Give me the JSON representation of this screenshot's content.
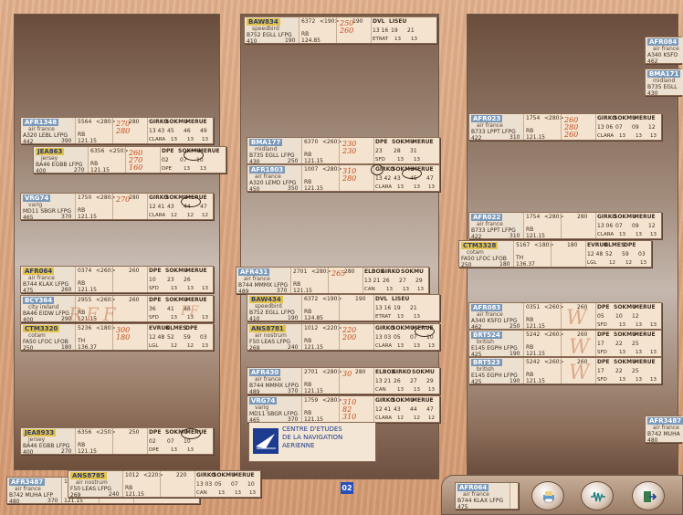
{
  "bays": {
    "left": "",
    "center": "",
    "right": ""
  },
  "logo": {
    "line1": "CENTRE D'ETUDES",
    "line2": "DE LA NAVIGATION",
    "line3": "AERIENNE"
  },
  "pager": {
    "value": "02"
  },
  "handwriting": {
    "ref": "REF",
    "ff": "FF",
    "w1": "W",
    "w2": "W",
    "w3": "W"
  },
  "strips": [
    {
      "id": "baw834",
      "cs": "BAW834",
      "sq": "6372",
      "lvl": "<190>",
      "x": "190",
      "co": "speedbird",
      "ac": "B752",
      "dep": "EGLL",
      "arr": "LFPG",
      "spd": "410",
      "alt": "190",
      "rb": "RB",
      "freq": "124.85",
      "h1": "250",
      "h2": "260",
      "a1": "DVL",
      "a2": "LISEU",
      "b1": "13 16",
      "b2": "19",
      "b3": "21",
      "c1": "ETRAT",
      "c2": "13",
      "c3": "13"
    },
    {
      "id": "afr1348",
      "cs": "AFR1348",
      "sq": "5564",
      "lvl": "<280>",
      "x": "280",
      "co": "air france",
      "ac": "A320",
      "dep": "LEBL",
      "arr": "LFPG",
      "spd": "442",
      "alt": "390",
      "rb": "RB",
      "freq": "121.15",
      "h1": "270",
      "h2": "280",
      "a1": "GIRKO",
      "a2": "SOKMU",
      "a3": "MERUE",
      "b1": "13 43",
      "b2": "45",
      "b3": "46",
      "b4": "49",
      "c1": "CLARA",
      "c2": "13",
      "c3": "13",
      "c4": "13"
    },
    {
      "id": "jea863",
      "cs": "JEA863",
      "sq": "6356",
      "lvl": "<250>",
      "x": "",
      "co": "jersey",
      "ac": "BA46",
      "dep": "EGBB",
      "arr": "LFPG",
      "spd": "400",
      "alt": "270",
      "rb": "RB",
      "freq": "121.15",
      "h1": "260",
      "h2": "270",
      "h3": "160",
      "a1": "DPE",
      "a2": "SOKMU",
      "a3": "MERUE",
      "b1": "02",
      "b2": "07",
      "b3": "10",
      "c1": "DPE",
      "c2": "13",
      "c3": "13"
    },
    {
      "id": "vrg74",
      "cs": "VRG74",
      "sq": "1750",
      "lvl": "<280>",
      "x": "280",
      "co": "varig",
      "ac": "MD11",
      "dep": "SBGR",
      "arr": "LFPG",
      "spd": "465",
      "alt": "370",
      "rb": "RB",
      "freq": "121.15",
      "h1": "270",
      "a1": "GIRKO",
      "a2": "SOKMU",
      "a3": "MERUE",
      "b1": "12 41",
      "b2": "43",
      "b3": "44",
      "b4": "47",
      "c1": "CLARA",
      "c2": "12",
      "c3": "12",
      "c4": "12"
    },
    {
      "id": "afr064",
      "cs": "AFR064",
      "sq": "0374",
      "lvl": "<260>",
      "x": "260",
      "co": "air france",
      "ac": "B744",
      "dep": "KLAX",
      "arr": "LFPG",
      "spd": "475",
      "alt": "260",
      "rb": "RB",
      "freq": "121.15",
      "a1": "DPE",
      "a2": "SOKMU",
      "a3": "MERUE",
      "b1": "10",
      "b2": "23",
      "b3": "26",
      "c1": "SFD",
      "c2": "13",
      "c3": "13",
      "c4": "13"
    },
    {
      "id": "bcy364",
      "cs": "BCY364",
      "sq": "2955",
      "lvl": "<260>",
      "x": "260",
      "co": "city ireland",
      "ac": "BA46",
      "dep": "EIDW",
      "arr": "LFPG",
      "spd": "400",
      "alt": "290",
      "rb": "RB",
      "freq": "121.15",
      "a1": "DPE",
      "a2": "SOKMU",
      "a3": "MERUE",
      "b1": "36",
      "b2": "41",
      "b3": "46",
      "c1": "SFD",
      "c2": "13",
      "c3": "13",
      "c4": "13"
    },
    {
      "id": "ctm3320",
      "cs": "CTM3320",
      "sq": "5236",
      "lvl": "<180>",
      "x": "",
      "co": "cotam",
      "ac": "FA50",
      "dep": "LFOC",
      "arr": "LFOB",
      "spd": "250",
      "alt": "180",
      "rb": "TH",
      "freq": "136.37",
      "h1": "300",
      "h2": "180",
      "a1": "EVRUK",
      "a2": "OLMES",
      "a3": "DPE",
      "b1": "12 48",
      "b2": "52",
      "b3": "59",
      "b4": "03",
      "c1": "LGL",
      "c2": "12",
      "c3": "12",
      "c4": "13"
    },
    {
      "id": "jea8933",
      "cs": "JEA8933",
      "sq": "6356",
      "lvl": "<250>",
      "x": "250",
      "co": "jersey",
      "ac": "BA46",
      "dep": "EGBB",
      "arr": "LFPG",
      "spd": "400",
      "alt": "270",
      "rb": "RB",
      "freq": "121.15",
      "a1": "DPE",
      "a2": "SOKMU",
      "a3": "MERUE",
      "b1": "02",
      "b2": "07",
      "b3": "10",
      "c1": "DPE",
      "c2": "13",
      "c3": "13"
    },
    {
      "id": "afr3487",
      "cs": "AFR3487",
      "sq": "17",
      "co": "air france",
      "ac": "B742",
      "dep": "MUHA",
      "arr": "LFP",
      "spd": "480",
      "alt": "370",
      "rb": "",
      "freq": "121.15"
    },
    {
      "id": "ans8785",
      "cs": "ANS8785",
      "sq": "1012",
      "lvl": "<220>",
      "x": "220",
      "co": "air nostrum",
      "ac": "F50",
      "dep": "LEAS",
      "arr": "LFPG",
      "spd": "269",
      "alt": "240",
      "rb": "RB",
      "freq": "121.15",
      "a1": "GIRKO",
      "a2": "SOKMU",
      "a3": "MERUE",
      "b1": "13 03",
      "b2": "05",
      "b3": "07",
      "b4": "10",
      "c1": "CAN",
      "c2": "13",
      "c3": "13",
      "c4": "13"
    },
    {
      "id": "bma177",
      "cs": "BMA177",
      "sq": "6370",
      "lvl": "<260>",
      "x": "",
      "co": "midland",
      "ac": "B735",
      "dep": "EGLL",
      "arr": "LFPG",
      "spd": "430",
      "alt": "250",
      "rb": "RB",
      "freq": "121.15",
      "h1": "230",
      "h2": "230",
      "a1": "DPE",
      "a2": "SOKMU",
      "a3": "MERUE",
      "b1": "23",
      "b2": "28",
      "b3": "31",
      "c1": "SFD",
      "c2": "13",
      "c3": "13"
    },
    {
      "id": "afr1803",
      "cs": "AFR1803",
      "sq": "1007",
      "lvl": "<280>",
      "x": "",
      "co": "air france",
      "ac": "A320",
      "dep": "LEMD",
      "arr": "LFPG",
      "spd": "450",
      "alt": "350",
      "rb": "RB",
      "freq": "121.15",
      "h1": "310",
      "h2": "280",
      "a1": "GIRKO",
      "a2": "SOKMU",
      "a3": "MERUE",
      "b1": "13 42",
      "b2": "43",
      "b3": "45",
      "b4": "47",
      "c1": "CLARA",
      "c2": "13",
      "c3": "13",
      "c4": "13"
    },
    {
      "id": "afr431",
      "cs": "AFR431",
      "sq": "2701",
      "lvl": "<280>",
      "x": "280",
      "co": "air france",
      "ac": "B744",
      "dep": "MMMX",
      "arr": "LFPG",
      "spd": "489",
      "alt": "370",
      "rb": "RB",
      "freq": "121.15",
      "h1": "265",
      "a1": "ELBOX",
      "a2": "GIRKO",
      "a3": "SOKMU",
      "b1": "13 21",
      "b2": "26",
      "b3": "27",
      "b4": "29",
      "c1": "CAN",
      "c2": "13",
      "c3": "13",
      "c4": "13"
    },
    {
      "id": "baw434",
      "cs": "BAW434",
      "sq": "6372",
      "lvl": "<190>",
      "x": "190",
      "co": "speedbird",
      "ac": "B752",
      "dep": "EGLL",
      "arr": "LFPO",
      "spd": "410",
      "alt": "190",
      "rb": "RB",
      "freq": "124.85",
      "a1": "DVL",
      "a2": "LISEU",
      "b1": "13 16",
      "b2": "19",
      "b3": "21",
      "c1": "ETRAT",
      "c2": "13",
      "c3": "13"
    },
    {
      "id": "ans8781",
      "cs": "ANS8781",
      "sq": "1012",
      "lvl": "<220>",
      "x": "",
      "co": "air nostrum",
      "ac": "F50",
      "dep": "LEAS",
      "arr": "LFPG",
      "spd": "269",
      "alt": "240",
      "rb": "RB",
      "freq": "121.15",
      "h1": "220",
      "h2": "200",
      "a1": "GIRKO",
      "a2": "SOKMU",
      "a3": "MERUE",
      "b1": "13 03",
      "b2": "05",
      "b3": "07",
      "b4": "10",
      "c1": "CLARA",
      "c2": "13",
      "c3": "13",
      "c4": "13"
    },
    {
      "id": "afr430",
      "cs": "AFR430",
      "sq": "2701",
      "lvl": "<280>",
      "x": "280",
      "co": "air france",
      "ac": "B744",
      "dep": "MMMX",
      "arr": "LFPG",
      "spd": "489",
      "alt": "370",
      "rb": "RB",
      "freq": "121.15",
      "h1": "30",
      "a1": "ELBOX",
      "a2": "GIRKO",
      "a3": "SOKMU",
      "b1": "13 21",
      "b2": "26",
      "b3": "27",
      "b4": "29",
      "c1": "CAN",
      "c2": "13",
      "c3": "13",
      "c4": "13"
    },
    {
      "id": "vrg74b",
      "cs": "VRG74",
      "sq": "1759",
      "lvl": "<280>",
      "x": "",
      "co": "varig",
      "ac": "MD11",
      "dep": "SBGR",
      "arr": "LFPG",
      "spd": "465",
      "alt": "370",
      "rb": "RB",
      "freq": "121.15",
      "h1": "310",
      "h2": "82",
      "h3": "310",
      "a1": "GIRKO",
      "a2": "SOKMU",
      "a3": "MERUE",
      "b1": "12 41",
      "b2": "43",
      "b3": "44",
      "b4": "47",
      "c1": "CLARA",
      "c2": "12",
      "c3": "12",
      "c4": "12"
    },
    {
      "id": "afr023",
      "cs": "AFR023",
      "sq": "1754",
      "lvl": "<280>",
      "x": "",
      "co": "air france",
      "ac": "B733",
      "dep": "LPPT",
      "arr": "LFPG",
      "spd": "422",
      "alt": "310",
      "rb": "RB",
      "freq": "121.15",
      "h1": "260",
      "h2": "280",
      "h3": "260",
      "a1": "GIRKO",
      "a2": "SOKMU",
      "a3": "MERUE",
      "b1": "13 06",
      "b2": "07",
      "b3": "09",
      "b4": "12",
      "c1": "CLARA",
      "c2": "13",
      "c3": "13",
      "c4": "13"
    },
    {
      "id": "afr022",
      "cs": "AFR022",
      "sq": "1754",
      "lvl": "<280>",
      "x": "280",
      "co": "air france",
      "ac": "B733",
      "dep": "LPPT",
      "arr": "LFPG",
      "spd": "422",
      "alt": "310",
      "rb": "RB",
      "freq": "121.15",
      "a1": "GIRKO",
      "a2": "SOKMU",
      "a3": "MERUE",
      "b1": "13 06",
      "b2": "07",
      "b3": "09",
      "b4": "12",
      "c1": "CLARA",
      "c2": "13",
      "c3": "13",
      "c4": "13"
    },
    {
      "id": "ctm3328",
      "cs": "CTM3328",
      "sq": "5167",
      "lvl": "<180>",
      "x": "180",
      "co": "cotam",
      "ac": "FA50",
      "dep": "LFOC",
      "arr": "LFOB",
      "spd": "250",
      "alt": "180",
      "rb": "TH",
      "freq": "136.37",
      "a1": "EVRUK",
      "a2": "OLMES",
      "a3": "DPE",
      "b1": "12 48",
      "b2": "52",
      "b3": "59",
      "b4": "03",
      "c1": "LGL",
      "c2": "12",
      "c3": "12",
      "c4": "13"
    },
    {
      "id": "afr083",
      "cs": "AFR083",
      "sq": "0351",
      "lvl": "<260>",
      "x": "260",
      "co": "air france",
      "ac": "A340",
      "dep": "KSFO",
      "arr": "LFPG",
      "spd": "462",
      "alt": "250",
      "rb": "RB",
      "freq": "121.15",
      "a1": "DPE",
      "a2": "SOKMU",
      "a3": "MERUE",
      "b1": "05",
      "b2": "10",
      "b3": "12",
      "c1": "SFD",
      "c2": "13",
      "c3": "13",
      "c4": "13"
    },
    {
      "id": "brt524",
      "cs": "BRT524",
      "sq": "5242",
      "lvl": "<260>",
      "x": "260",
      "co": "british",
      "ac": "E145",
      "dep": "EGPH",
      "arr": "LFPG",
      "spd": "425",
      "alt": "190",
      "rb": "RB",
      "freq": "121.15",
      "a1": "DPE",
      "a2": "SOKMU",
      "a3": "MERUE",
      "b1": "17",
      "b2": "22",
      "b3": "25",
      "c1": "SFD",
      "c2": "13",
      "c3": "13",
      "c4": "13"
    },
    {
      "id": "brt523",
      "cs": "BRT523",
      "sq": "5242",
      "lvl": "<260>",
      "x": "260",
      "co": "british",
      "ac": "E145",
      "dep": "EGPH",
      "arr": "LFPG",
      "spd": "425",
      "alt": "190",
      "rb": "RB",
      "freq": "121.15",
      "a1": "DPE",
      "a2": "SOKMU",
      "a3": "MERUE",
      "b1": "17",
      "b2": "22",
      "b3": "25",
      "c1": "SFD",
      "c2": "13",
      "c3": "13",
      "c4": "13"
    },
    {
      "id": "afr084",
      "cs": "AFR084",
      "co": "air france",
      "ac": "A340",
      "dep": "KSFO",
      "spd": "462"
    },
    {
      "id": "bma171",
      "cs": "BMA171",
      "co": "midland",
      "ac": "B735",
      "dep": "EGLL",
      "spd": "430"
    },
    {
      "id": "afr3487r",
      "cs": "AFR3487",
      "co": "air france",
      "ac": "B742",
      "dep": "MUHA",
      "spd": "480"
    },
    {
      "id": "afr064b",
      "cs": "AFR064",
      "sq": "0374",
      "co": "air france",
      "ac": "B744",
      "dep": "KLAX",
      "arr": "LFPG",
      "spd": "475",
      "alt": "26"
    }
  ]
}
